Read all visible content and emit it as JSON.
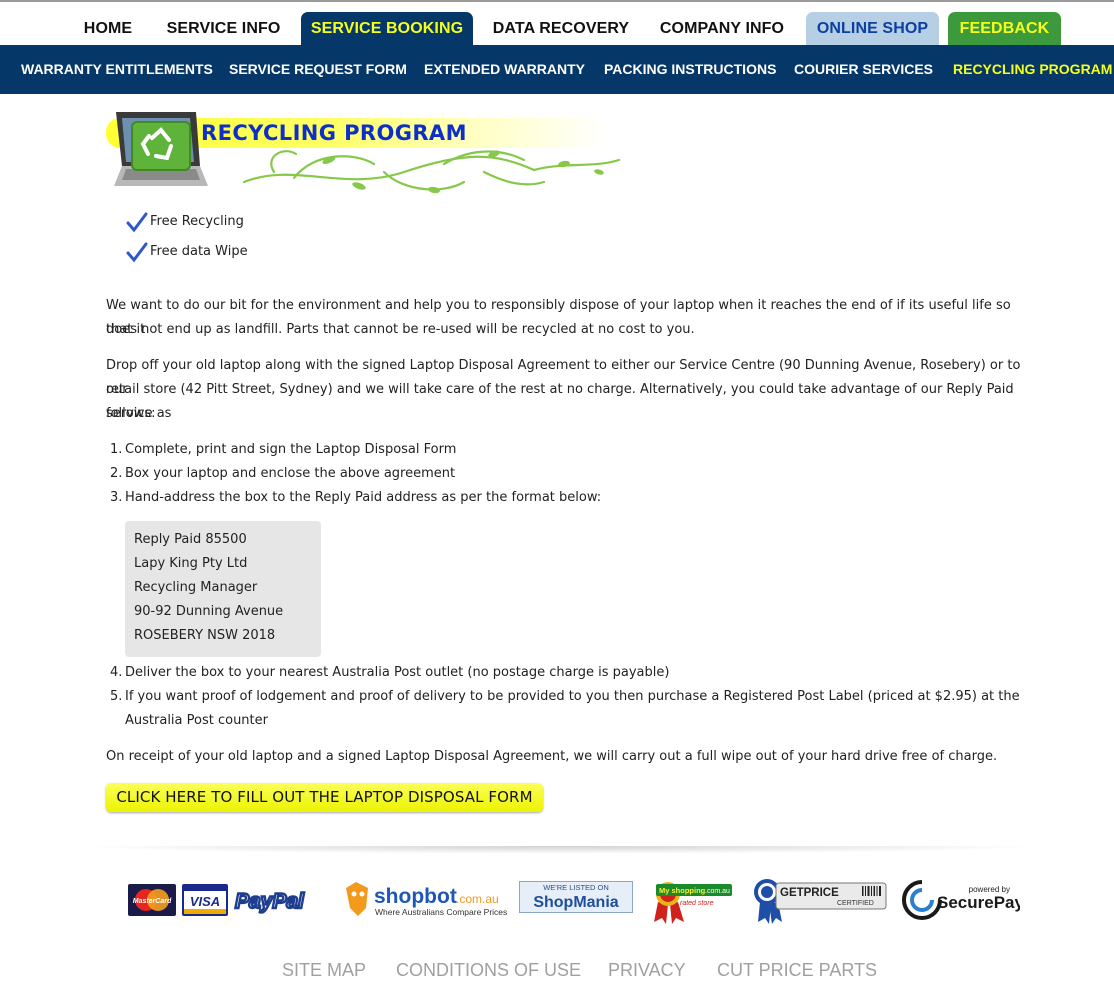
{
  "tabs": {
    "home": "HOME",
    "service_info": "SERVICE INFO",
    "service_booking": "SERVICE BOOKING",
    "data_recovery": "DATA RECOVERY",
    "company_info": "COMPANY INFO",
    "online_shop": "ONLINE SHOP",
    "feedback": "FEEDBACK"
  },
  "subnav": {
    "warranty": "WARRANTY ENTITLEMENTS",
    "service_request": "SERVICE REQUEST FORM",
    "extended": "EXTENDED WARRANTY",
    "packing": "PACKING INSTRUCTIONS",
    "courier": "COURIER SERVICES",
    "recycling": "RECYCLING PROGRAM"
  },
  "banner": {
    "title": "RECYCLING PROGRAM"
  },
  "checklist": [
    "Free Recycling",
    "Free data Wipe"
  ],
  "paragraphs": {
    "intro_1": "We want to do our bit for the environment and help you to responsibly dispose of your laptop when it reaches the end of if its useful life so that it",
    "intro_2": "does not end up as landfill. Parts that cannot be re-used will be recycled at no cost to you.",
    "drop_1": "Drop off your old laptop along with the signed Laptop Disposal Agreement to either our Service Centre (90 Dunning Avenue, Rosebery) or to our",
    "drop_2": "retail store (42 Pitt Street, Sydney) and we will take care of the rest at no charge. Alternatively, you could take advantage of our Reply Paid service as",
    "drop_3": "follows:",
    "receipt": "On receipt of your old laptop and a signed Laptop Disposal Agreement, we will carry out a full wipe out of your hard drive free of charge."
  },
  "steps": [
    {
      "num": "1.",
      "text": "Complete, print and sign the Laptop Disposal Form"
    },
    {
      "num": "2.",
      "text": "Box your laptop and enclose the above agreement"
    },
    {
      "num": "3.",
      "text": "Hand-address the box to the Reply Paid address as per the format below:"
    },
    {
      "num": "4.",
      "text": "Deliver the box to your nearest Australia Post outlet (no postage charge is payable)"
    },
    {
      "num": "5.",
      "text": "If you want proof of lodgement and proof of delivery to be provided to you then purchase a Registered Post Label (priced at $2.95) at the"
    },
    {
      "num": "",
      "text": "Australia Post counter"
    }
  ],
  "address": [
    "Reply Paid 85500",
    "Lapy King Pty Ltd",
    "Recycling Manager",
    "90-92 Dunning Avenue",
    "ROSEBERY NSW 2018"
  ],
  "cta": {
    "label": "CLICK HERE TO FILL OUT THE LAPTOP DISPOSAL FORM"
  },
  "logos": {
    "mastercard": "MasterCard",
    "visa": "VISA",
    "paypal": "PayPal",
    "shopbot_name": "shopbot",
    "shopbot_domain": ".com.au",
    "shopbot_tagline": "Where Australians Compare Prices",
    "shopmania_top": "WE'RE LISTED ON",
    "shopmania_name": "ShopMania",
    "myshopping_name": "My shopping",
    "myshopping_domain": ".com.au",
    "myshopping_tag": "rated store",
    "getprice_name": "GETPRICE",
    "getprice_tag": "CERTIFIED",
    "securepay_top": "powered by",
    "securepay_name": "SecurePay"
  },
  "footer": {
    "sitemap": "SITE MAP",
    "conditions": "CONDITIONS OF USE",
    "privacy": "PRIVACY",
    "cutprice": "CUT PRICE PARTS"
  },
  "colors": {
    "nav_blue": "#063769",
    "active_yellow": "#f6ff1a",
    "shop_tab": "#b6cfe4",
    "feedback_tab": "#3c9a3c",
    "title_blue": "#0d2fc8"
  }
}
